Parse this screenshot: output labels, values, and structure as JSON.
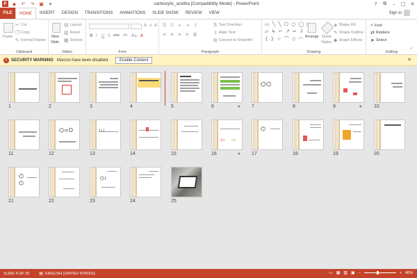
{
  "window": {
    "title": "carboxylic_acidha [Compatibility Mode] - PowerPoint",
    "app_logo": "P",
    "controls": {
      "help": "?",
      "restore": "⧉",
      "minimize": "–",
      "maximize": "□",
      "close": "✕"
    }
  },
  "qat": {
    "save": "save-icon",
    "undo": "↶",
    "redo": "↷",
    "start": "▣",
    "customize": "▾"
  },
  "tabs": [
    {
      "label": "FILE"
    },
    {
      "label": "HOME"
    },
    {
      "label": "INSERT"
    },
    {
      "label": "DESIGN"
    },
    {
      "label": "TRANSITIONS"
    },
    {
      "label": "ANIMATIONS"
    },
    {
      "label": "SLIDE SHOW"
    },
    {
      "label": "REVIEW"
    },
    {
      "label": "VIEW"
    }
  ],
  "account": {
    "sign_in": "Sign in"
  },
  "ribbon": {
    "clipboard": {
      "label": "Clipboard",
      "paste": "Paste",
      "cut": "Cut",
      "copy": "Copy",
      "format_painter": "Format Painter"
    },
    "slides": {
      "label": "Slides",
      "new_slide": "New",
      "new_slide2": "Slide",
      "layout": "Layout",
      "reset": "Reset",
      "section": "Section"
    },
    "font": {
      "label": "Font",
      "bold": "B",
      "italic": "I",
      "underline": "U",
      "strike": "S",
      "shadow": "abc",
      "spacing": "AV",
      "case": "Aa",
      "color": "A",
      "grow": "A",
      "shrink": "A",
      "clear": "A"
    },
    "paragraph": {
      "label": "Paragraph",
      "text_direction": "Text Direction",
      "align_text": "Align Text",
      "smartart": "Convert to SmartArt"
    },
    "drawing": {
      "label": "Drawing",
      "arrange": "Arrange",
      "quick_styles": "Quick",
      "quick_styles2": "Styles",
      "shape_fill": "Shape Fill",
      "shape_outline": "Shape Outline",
      "shape_effects": "Shape Effects"
    },
    "editing": {
      "label": "Editing",
      "find": "Find",
      "replace": "Replace",
      "select": "Select"
    }
  },
  "security": {
    "title": "SECURITY WARNING",
    "message": "Macros have been disabled.",
    "button": "Enable Content",
    "close": "✕"
  },
  "slides": [
    {
      "n": "1"
    },
    {
      "n": "2"
    },
    {
      "n": "3"
    },
    {
      "n": "4"
    },
    {
      "n": "5"
    },
    {
      "n": "6",
      "star": "★"
    },
    {
      "n": "7"
    },
    {
      "n": "8"
    },
    {
      "n": "9",
      "star": "★"
    },
    {
      "n": "10"
    },
    {
      "n": "11"
    },
    {
      "n": "12"
    },
    {
      "n": "13"
    },
    {
      "n": "14"
    },
    {
      "n": "15"
    },
    {
      "n": "16",
      "star": "★"
    },
    {
      "n": "17"
    },
    {
      "n": "18"
    },
    {
      "n": "19"
    },
    {
      "n": "20"
    },
    {
      "n": "21"
    },
    {
      "n": "22"
    },
    {
      "n": "23"
    },
    {
      "n": "24"
    },
    {
      "n": "25"
    }
  ],
  "status": {
    "slide": "SLIDE 4 OF 25",
    "language": "ENGLISH (UNITED STATES)",
    "zoom": "40%",
    "zoom_minus": "–",
    "zoom_plus": "+"
  },
  "colors": {
    "accent": "#c4442b",
    "warning_bar": "#fff4c2"
  }
}
